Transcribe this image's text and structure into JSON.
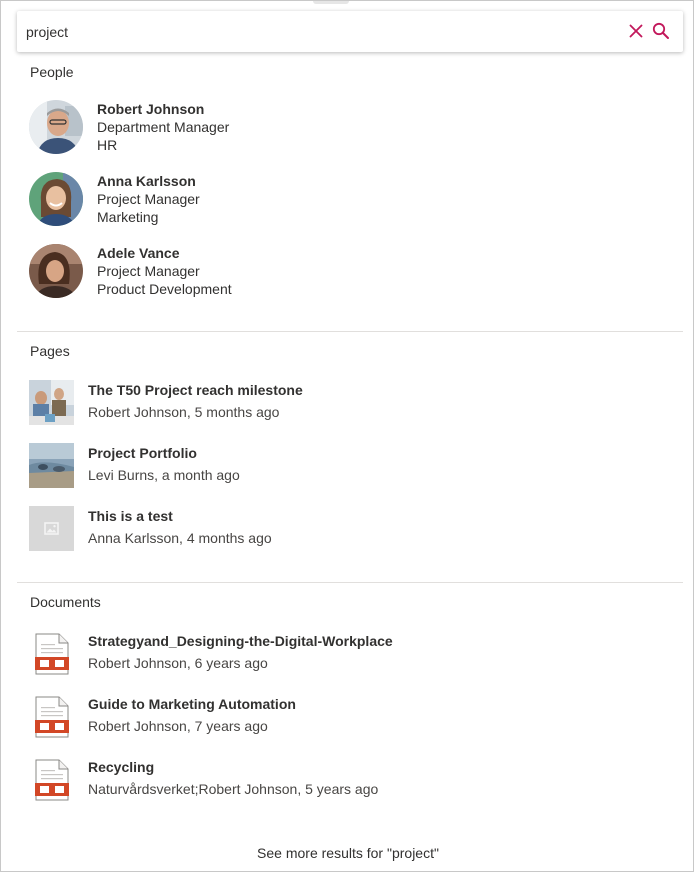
{
  "search": {
    "value": "project"
  },
  "sections": {
    "people": {
      "title": "People",
      "items": [
        {
          "name": "Robert Johnson",
          "title": "Department Manager",
          "department": "HR"
        },
        {
          "name": "Anna Karlsson",
          "title": "Project Manager",
          "department": "Marketing"
        },
        {
          "name": "Adele Vance",
          "title": "Project Manager",
          "department": "Product Development"
        }
      ]
    },
    "pages": {
      "title": "Pages",
      "items": [
        {
          "title": "The T50 Project reach milestone",
          "meta": "Robert Johnson, 5 months ago"
        },
        {
          "title": "Project Portfolio",
          "meta": "Levi Burns, a month ago"
        },
        {
          "title": "This is a test",
          "meta": "Anna Karlsson, 4 months ago"
        }
      ]
    },
    "documents": {
      "title": "Documents",
      "items": [
        {
          "title": "Strategyand_Designing-the-Digital-Workplace",
          "meta": "Robert Johnson, 6 years ago"
        },
        {
          "title": "Guide to Marketing Automation",
          "meta": "Robert Johnson, 7 years ago"
        },
        {
          "title": "Recycling",
          "meta": "Naturvårdsverket;Robert Johnson, 5 years ago"
        }
      ]
    }
  },
  "see_more": "See more results for \"project\"",
  "icons": {
    "clear": "close-icon",
    "search": "search-icon",
    "document": "document-icon",
    "placeholder": "image-placeholder-icon"
  },
  "colors": {
    "accent": "#c2185b",
    "doc_red": "#d24726",
    "divider": "#e1dfdd"
  }
}
